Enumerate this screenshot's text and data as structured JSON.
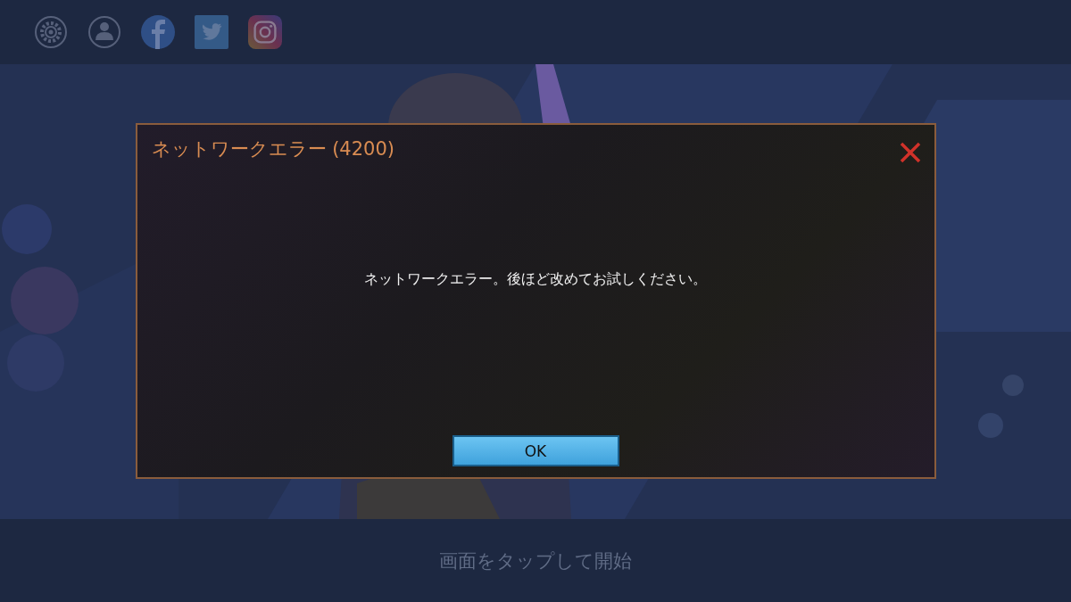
{
  "dialog": {
    "title": "ネットワークエラー (4200)",
    "message": "ネットワークエラー。後ほど改めてお試しください。",
    "button": "OK"
  },
  "footer": {
    "prompt": "画面をタップして開始"
  }
}
